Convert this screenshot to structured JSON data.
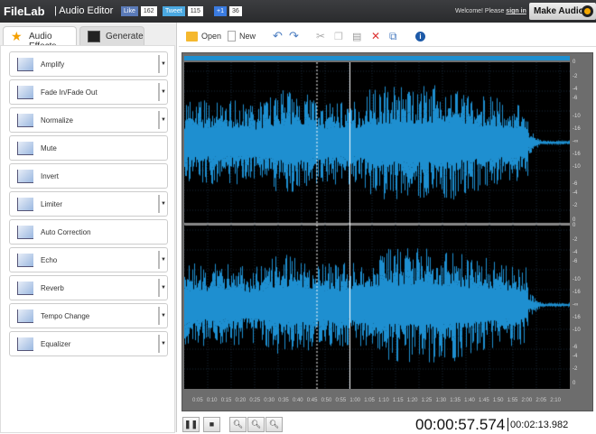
{
  "header": {
    "logo": "FileLab",
    "app_title": "| Audio Editor",
    "like_label": "Like",
    "like_count": "162",
    "tweet_label": "Tweet",
    "tweet_count": "115",
    "plus_label": "+1",
    "plus_count": "36",
    "welcome": "Welcome! Please",
    "signin": "sign in",
    "make_audio": "Make Audio"
  },
  "tabs": [
    {
      "label": "Audio Effects",
      "icon": "star-icon",
      "active": true
    },
    {
      "label": "Generate",
      "icon": "waveform-monitor-icon",
      "active": false
    }
  ],
  "effects": [
    {
      "label": "Amplify",
      "icon": "amplify-icon",
      "dropdown": true
    },
    {
      "label": "Fade In/Fade Out",
      "icon": "fade-icon",
      "dropdown": true
    },
    {
      "label": "Normalize",
      "icon": "normalize-icon",
      "dropdown": true
    },
    {
      "label": "Mute",
      "icon": "mute-icon",
      "dropdown": false
    },
    {
      "label": "Invert",
      "icon": "invert-icon",
      "dropdown": false
    },
    {
      "label": "Limiter",
      "icon": "limiter-icon",
      "dropdown": true
    },
    {
      "label": "Auto Correction",
      "icon": "auto-correction-icon",
      "dropdown": false
    },
    {
      "label": "Echo",
      "icon": "echo-icon",
      "dropdown": true
    },
    {
      "label": "Reverb",
      "icon": "reverb-icon",
      "dropdown": true
    },
    {
      "label": "Tempo Change",
      "icon": "tempo-icon",
      "dropdown": true
    },
    {
      "label": "Equalizer",
      "icon": "equalizer-icon",
      "dropdown": true
    }
  ],
  "toolbar": {
    "open": "Open",
    "new": "New"
  },
  "waveform": {
    "color": "#1e8fd0",
    "db_scale": [
      "0",
      "-2",
      "-4",
      "-6",
      "-10",
      "-16",
      "-∞",
      "-16",
      "-10",
      "-6",
      "-4",
      "-2",
      "0"
    ],
    "time_ticks": [
      "0:05",
      "0:10",
      "0:15",
      "0:20",
      "0:25",
      "0:30",
      "0:35",
      "0:40",
      "0:45",
      "0:50",
      "0:55",
      "1:00",
      "1:05",
      "1:10",
      "1:15",
      "1:20",
      "1:25",
      "1:30",
      "1:35",
      "1:40",
      "1:45",
      "1:50",
      "1:55",
      "2:00",
      "2:05",
      "2:10"
    ]
  },
  "playback": {
    "current_time": "00:00:57.574",
    "total_time": "00:02:13.982"
  }
}
